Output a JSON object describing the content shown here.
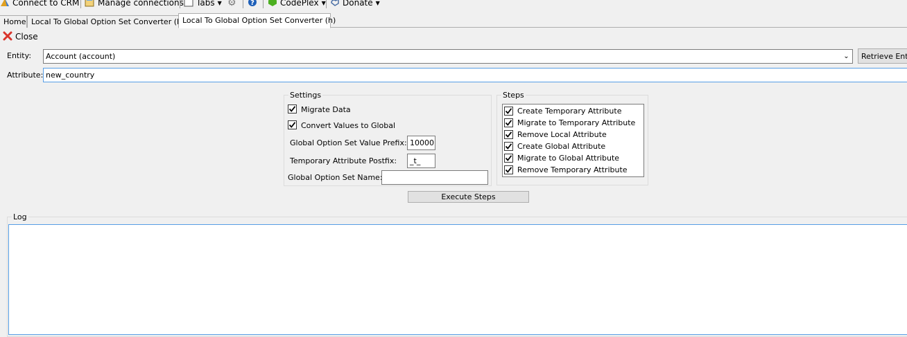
{
  "toolbar": {
    "connect_label": "Connect to CRM",
    "manage_label": "Manage connections",
    "tabs_label": "Tabs",
    "codeplex_label": "CodePlex",
    "donate_label": "Donate"
  },
  "tabs": [
    {
      "label": "Home"
    },
    {
      "label": "Local To Global Option Set Converter (h)"
    },
    {
      "label": "Local To Global Option Set Converter (h)"
    }
  ],
  "close_label": "Close",
  "entity": {
    "label": "Entity:",
    "value": "Account (account)",
    "retrieve_label": "Retrieve Entities"
  },
  "attribute": {
    "label": "Attribute:",
    "value": "new_country"
  },
  "settings": {
    "legend": "Settings",
    "migrate_data_label": "Migrate Data",
    "migrate_data_checked": true,
    "convert_values_label": "Convert Values to Global",
    "convert_values_checked": true,
    "prefix_label": "Global Option Set Value Prefix:",
    "prefix_value": "10000",
    "postfix_label": "Temporary Attribute Postfix:",
    "postfix_value": "_t_",
    "name_label": "Global Option Set Name:",
    "name_value": ""
  },
  "steps": {
    "legend": "Steps",
    "items": [
      {
        "label": "Create Temporary Attribute",
        "checked": true
      },
      {
        "label": "Migrate to Temporary Attribute",
        "checked": true
      },
      {
        "label": "Remove Local Attribute",
        "checked": true
      },
      {
        "label": "Create Global Attribute",
        "checked": true
      },
      {
        "label": "Migrate to Global Attribute",
        "checked": true
      },
      {
        "label": "Remove Temporary Attribute",
        "checked": true
      }
    ]
  },
  "execute_label": "Execute Steps",
  "log": {
    "legend": "Log",
    "content": ""
  },
  "colors": {
    "accent_border": "#569de5",
    "close_red": "#d9342b",
    "codeplex_green": "#4caf20",
    "help_blue": "#1e5fb8"
  }
}
